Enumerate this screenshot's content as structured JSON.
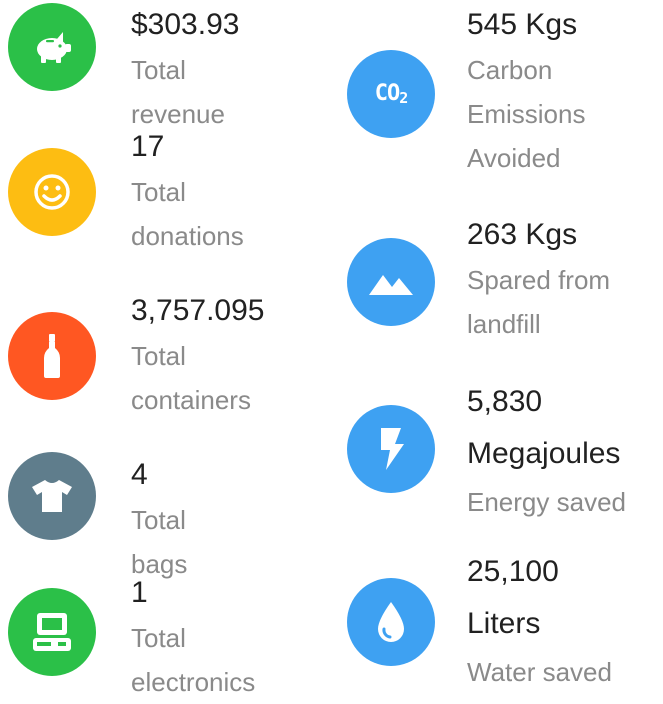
{
  "left_stats": [
    {
      "value": "$303.93",
      "label": "Total revenue",
      "icon": "piggy-bank-icon",
      "color": "#2bc048"
    },
    {
      "value": "17",
      "label": "Total donations",
      "icon": "smiley-face-icon",
      "color": "#fdbd12"
    },
    {
      "value": "3,757.095",
      "label": "Total containers",
      "icon": "bottle-icon",
      "color": "#ff5722"
    },
    {
      "value": "4",
      "label": "Total bags",
      "icon": "tshirt-icon",
      "color": "#5f7d8c"
    },
    {
      "value": "1",
      "label": "Total electronics",
      "icon": "computer-icon",
      "color": "#2bc048"
    }
  ],
  "right_stats": [
    {
      "value": "545 Kgs",
      "label": "Carbon Emissions Avoided",
      "icon": "co2-icon",
      "icon_text": "CO",
      "icon_sub": "2",
      "color": "#3ea1f2"
    },
    {
      "value": "263 Kgs",
      "label": "Spared from landfill",
      "icon": "mountain-icon",
      "color": "#3ea1f2"
    },
    {
      "value": "5,830 Megajoules",
      "label": "Energy saved",
      "icon": "lightning-bolt-icon",
      "color": "#3ea1f2"
    },
    {
      "value": "25,100 Liters",
      "label": "Water saved",
      "icon": "water-drop-icon",
      "color": "#3ea1f2"
    }
  ]
}
